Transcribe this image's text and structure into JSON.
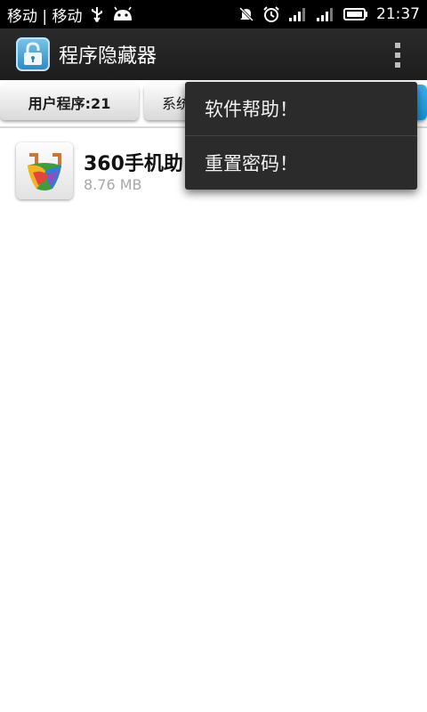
{
  "status_bar": {
    "carrier": "移动 | 移动",
    "time": "21:37"
  },
  "action_bar": {
    "title": "程序隐藏器"
  },
  "tabs": {
    "user": "用户程序:21",
    "system": "系统"
  },
  "apps": [
    {
      "name": "360手机助",
      "size": "8.76 MB"
    }
  ],
  "menu": {
    "items": [
      "软件帮助！",
      "重置密码！"
    ]
  },
  "colors": {
    "status_bar": "#000000",
    "action_bar": "#262626",
    "menu_bg": "#2b2b2b",
    "tab_accent": "#2aa0e0"
  }
}
